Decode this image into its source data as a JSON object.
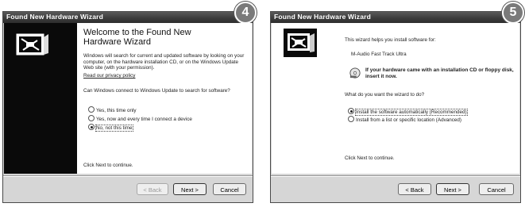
{
  "window1": {
    "badge": "4",
    "title": "Found New Hardware Wizard",
    "heading": "Welcome to the Found New Hardware Wizard",
    "intro": "Windows will search for current and updated software by looking on your computer, on the hardware installation CD, or on the Windows Update Web site (with your permission).",
    "privacy_link": "Read our privacy policy",
    "question": "Can Windows connect to Windows Update to search for software?",
    "options": [
      "Yes, this time only",
      "Yes, now and every time I connect a device",
      "No, not this time"
    ],
    "selected_option": 2,
    "footer_text": "Click Next to continue.",
    "buttons": {
      "back": "< Back",
      "next": "Next >",
      "cancel": "Cancel"
    }
  },
  "window2": {
    "badge": "5",
    "title": "Found New Hardware Wizard",
    "intro": "This wizard helps you install software for:",
    "device": "M-Audio Fast Track Ultra",
    "cd_notice": "If your hardware came with an installation CD or floppy disk, insert it now.",
    "question": "What do you want the wizard to do?",
    "options": [
      "Install the software automatically (Recommended)",
      "Install from a list or specific location (Advanced)"
    ],
    "selected_option": 0,
    "footer_text": "Click Next to continue.",
    "buttons": {
      "back": "< Back",
      "next": "Next >",
      "cancel": "Cancel"
    }
  }
}
